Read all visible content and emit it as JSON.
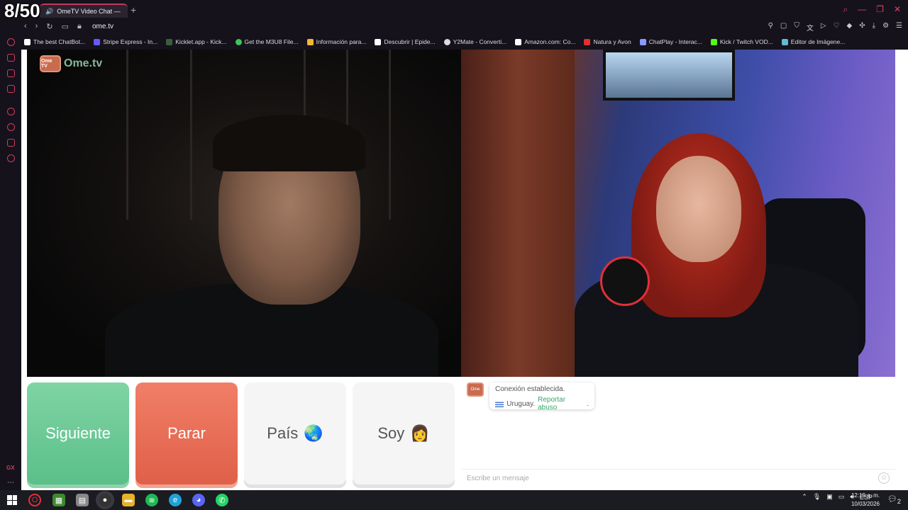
{
  "overlay": {
    "counter": "8/50"
  },
  "browser": {
    "tab_title": "OmeTV Video Chat — ",
    "new_tab": "+",
    "url": "ome.tv",
    "bookmarks": [
      {
        "label": "The best ChatBot...",
        "color": "#ffffff"
      },
      {
        "label": "Stripe Express - In...",
        "color": "#635bff"
      },
      {
        "label": "Kicklet.app - Kick...",
        "color": "#3a5f3a"
      },
      {
        "label": "Get the M3U8 File...",
        "color": "#3ec45b"
      },
      {
        "label": "Información para...",
        "color": "#f2b632"
      },
      {
        "label": "Descubrir | Epide...",
        "color": "#ffffff"
      },
      {
        "label": "Y2Mate - Converti...",
        "color": "#dddddd"
      },
      {
        "label": "Amazon.com: Co...",
        "color": "#ffffff"
      },
      {
        "label": "Natura y Avon",
        "color": "#e03030"
      },
      {
        "label": "ChatPlay - Interac...",
        "color": "#8899ff"
      },
      {
        "label": "Kick / Twitch VOD...",
        "color": "#53fc18"
      },
      {
        "label": "Editor de Imágene...",
        "color": "#5fbcd3"
      }
    ]
  },
  "app": {
    "logo_badge": "Ome TV",
    "logo_text": "Ome.tv",
    "buttons": {
      "next": "Siguiente",
      "stop": "Parar",
      "country": "País",
      "country_emoji": "🌏",
      "gender": "Soy",
      "gender_emoji": "👩"
    },
    "chat": {
      "avatar_badge": "Ome TV",
      "status": "Conexión establecida.",
      "country": "Uruguay.",
      "report": "Reportar abuso",
      "report_suffix": ".",
      "placeholder": "Escribe un mensaje"
    }
  },
  "taskbar": {
    "lang": "ESP",
    "time": "12:19 a. m.",
    "date": "10/03/2026",
    "notifications": "2"
  },
  "colors": {
    "accent": "#d23b5c",
    "next": "#6cc997",
    "stop": "#e86f57",
    "link": "#3aa66b"
  }
}
